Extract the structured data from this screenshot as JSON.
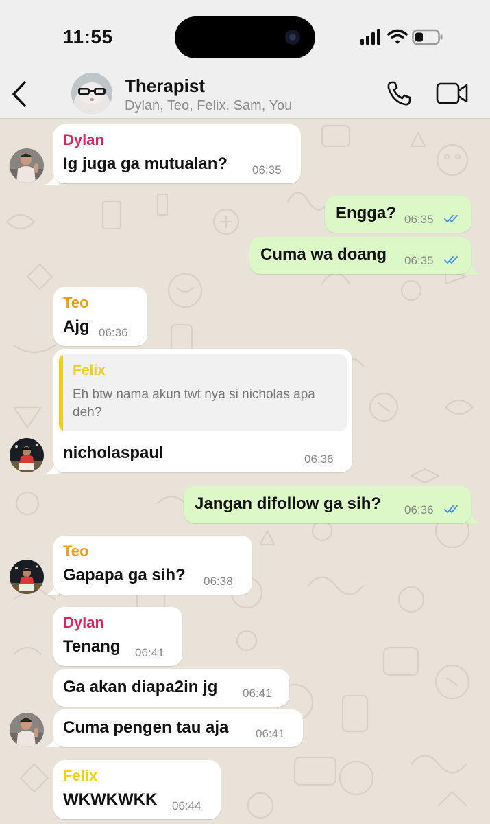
{
  "status_bar": {
    "time": "11:55"
  },
  "header": {
    "title": "Therapist",
    "members": "Dylan, Teo, Felix, Sam, You",
    "back_icon": "chevron-left-icon",
    "voice_call_icon": "phone-icon",
    "video_call_icon": "video-camera-icon"
  },
  "colors": {
    "incoming_bubble": "#ffffff",
    "outgoing_bubble": "#dcf8c7",
    "wallpaper": "#e9e2d8",
    "read_ticks": "#3b8ef0",
    "dylan": "#e0245e",
    "teo": "#f59c12",
    "felix": "#f2cf16"
  },
  "messages": [
    {
      "sender": "Dylan",
      "text": "Ig juga ga mutualan?",
      "time": "06:35"
    },
    {
      "text": "Engga?",
      "time": "06:35",
      "status": "read"
    },
    {
      "text": "Cuma wa doang",
      "time": "06:35",
      "status": "read"
    },
    {
      "sender": "Teo",
      "text": "Ajg",
      "time": "06:36"
    },
    {
      "quote": {
        "sender": "Felix",
        "text": "Eh btw nama akun twt nya si nicholas apa deh?"
      },
      "text": "nicholaspaul",
      "time": "06:36"
    },
    {
      "text": "Jangan difollow ga sih?",
      "time": "06:36",
      "status": "read"
    },
    {
      "sender": "Teo",
      "text": "Gapapa ga sih?",
      "time": "06:38"
    },
    {
      "sender": "Dylan",
      "text": "Tenang",
      "time": "06:41"
    },
    {
      "text": "Ga akan diapa2in jg",
      "time": "06:41"
    },
    {
      "text": "Cuma pengen tau aja",
      "time": "06:41"
    },
    {
      "sender": "Felix",
      "text": "WKWKWKK",
      "time": "06:44"
    }
  ]
}
